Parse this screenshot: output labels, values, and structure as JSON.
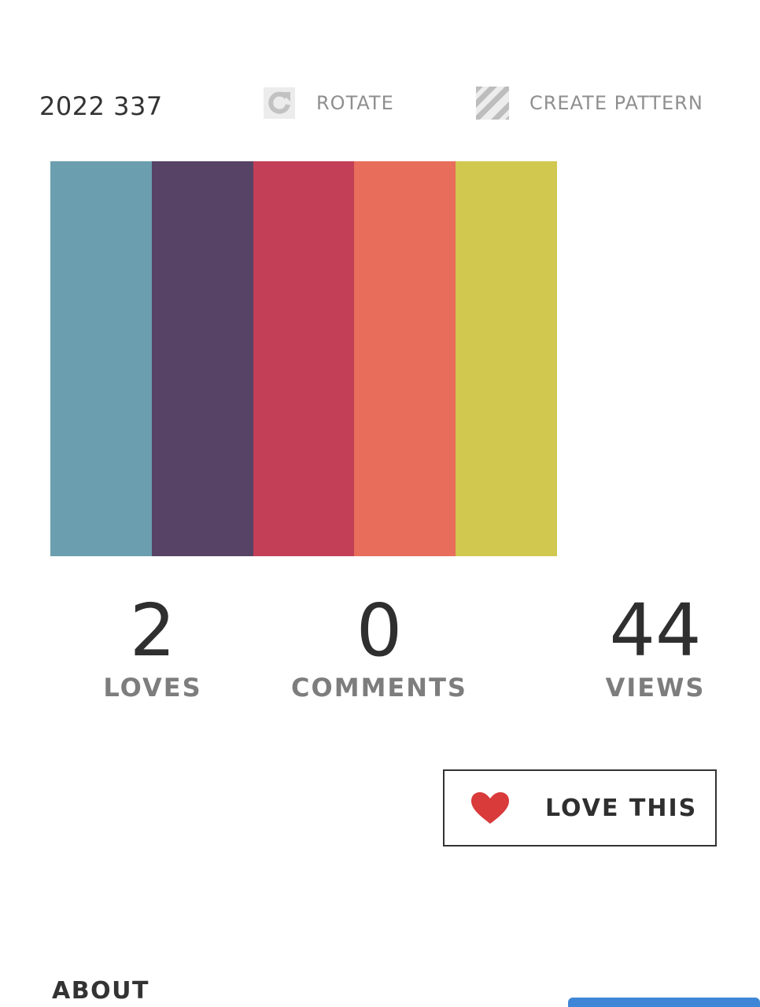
{
  "palette": {
    "title": "2022 337",
    "colors": [
      "#6b9eae",
      "#574365",
      "#c33e57",
      "#e86d5a",
      "#d1c84f"
    ]
  },
  "toolbar": {
    "rotate": {
      "label": "ROTATE",
      "icon": "rotate-icon"
    },
    "create_pattern": {
      "label": "CREATE PATTERN",
      "icon": "pattern-icon"
    }
  },
  "stats": {
    "loves": {
      "value": "2",
      "label": "LOVES"
    },
    "comments": {
      "value": "0",
      "label": "COMMENTS"
    },
    "views": {
      "value": "44",
      "label": "VIEWS"
    }
  },
  "love_button": {
    "label": "LOVE THIS",
    "icon": "heart-icon",
    "icon_color": "#d93a3a"
  },
  "about": {
    "heading": "ABOUT"
  }
}
